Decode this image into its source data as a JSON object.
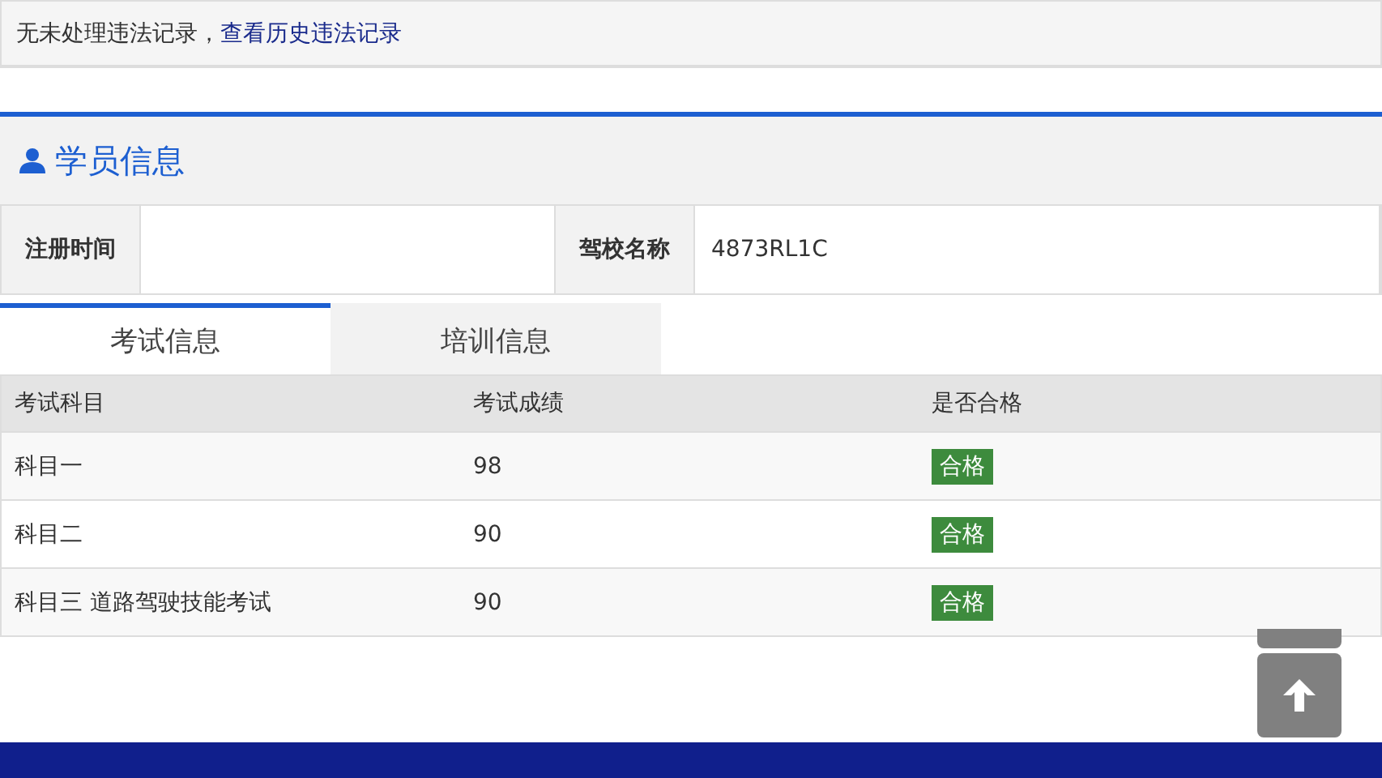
{
  "notice": {
    "text": "无未处理违法记录，",
    "link": "查看历史违法记录"
  },
  "section": {
    "title": "学员信息"
  },
  "info": [
    {
      "label": "注册时间"
    },
    {
      "label": "驾校名称",
      "value": "4873RL1C"
    }
  ],
  "tabs": [
    {
      "label": "考试信息",
      "selected": true
    },
    {
      "label": "培训信息",
      "selected": false
    }
  ],
  "table": {
    "columns": [
      "考试科目",
      "考试成绩",
      "是否合格"
    ],
    "rows": [
      {
        "subject": "科目一",
        "score": "98",
        "result": "合格",
        "passed": true
      },
      {
        "subject": "科目二",
        "score": "90",
        "result": "合格",
        "passed": true
      },
      {
        "subject": "科目三 道路驾驶技能考试",
        "score": "90",
        "result": "合格",
        "passed": true
      }
    ]
  }
}
